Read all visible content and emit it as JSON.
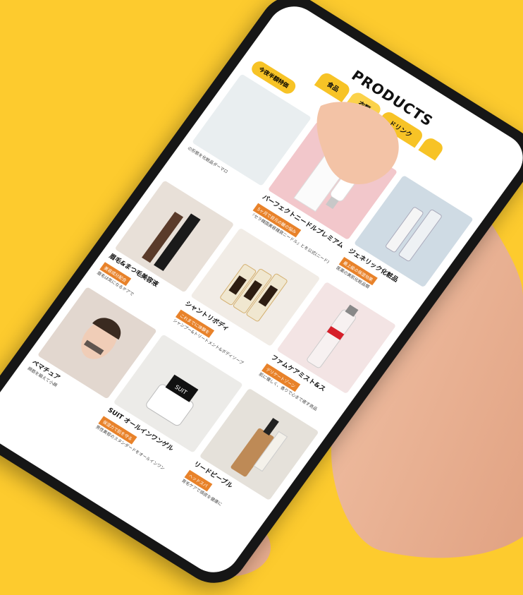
{
  "background_color": "#FDCB2E",
  "screen": {
    "brand": "PRODUCTS",
    "tabs": [
      "食品",
      "衣類",
      "ドリンク",
      ""
    ],
    "subtabs": [
      "今夜半額特価"
    ],
    "products": [
      {
        "name": "",
        "badge": "",
        "desc": "の形態を化粧品ダーマロ",
        "img_color": "#e9eef0"
      },
      {
        "name": "パーフェクトニードルプレミアム",
        "badge": "5ヶ月で目元の皺の悩み",
        "desc": "『セラ韓国美容雑貨ニードル』とを公式(ニード)",
        "img_color": "#f2c7cb"
      },
      {
        "name": "ジェネリック化粧品",
        "badge": "最上級の保湿効果",
        "desc": "医薬の美肌化粧品類",
        "img_color": "#cfdbe4"
      },
      {
        "name": "眉毛&まつ毛美容液",
        "badge": "美容成分配合",
        "desc": "眉毛は気になるケアで",
        "img_color": "#e8e0d8"
      },
      {
        "name": "シャントリボディ",
        "badge": "これまでに体験を",
        "desc": "シャンプー&トリートメント&ボディソープ",
        "img_color": "#f1ece6"
      },
      {
        "name": "ファムケアミスト&ス",
        "badge": "デリケートゾーン",
        "desc": "肌に優しく、香りで心まで癒す商品",
        "img_color": "#f3e4e4"
      },
      {
        "name": "ペマチュア",
        "badge": "",
        "desc": "顔筋を鍛えて小顔",
        "img_color": "#e2d7cf"
      },
      {
        "name": "SUIT オールインワンゲル",
        "badge": "保湿力で肌を守る",
        "desc": "男性美容のスタンダードをオールインワン",
        "img_color": "#ecebe8"
      },
      {
        "name": "リードビーブル",
        "badge": "ヘッドスパ",
        "desc": "育毛ケアで頭皮を健康に",
        "img_color": "#e5e1da"
      }
    ]
  }
}
